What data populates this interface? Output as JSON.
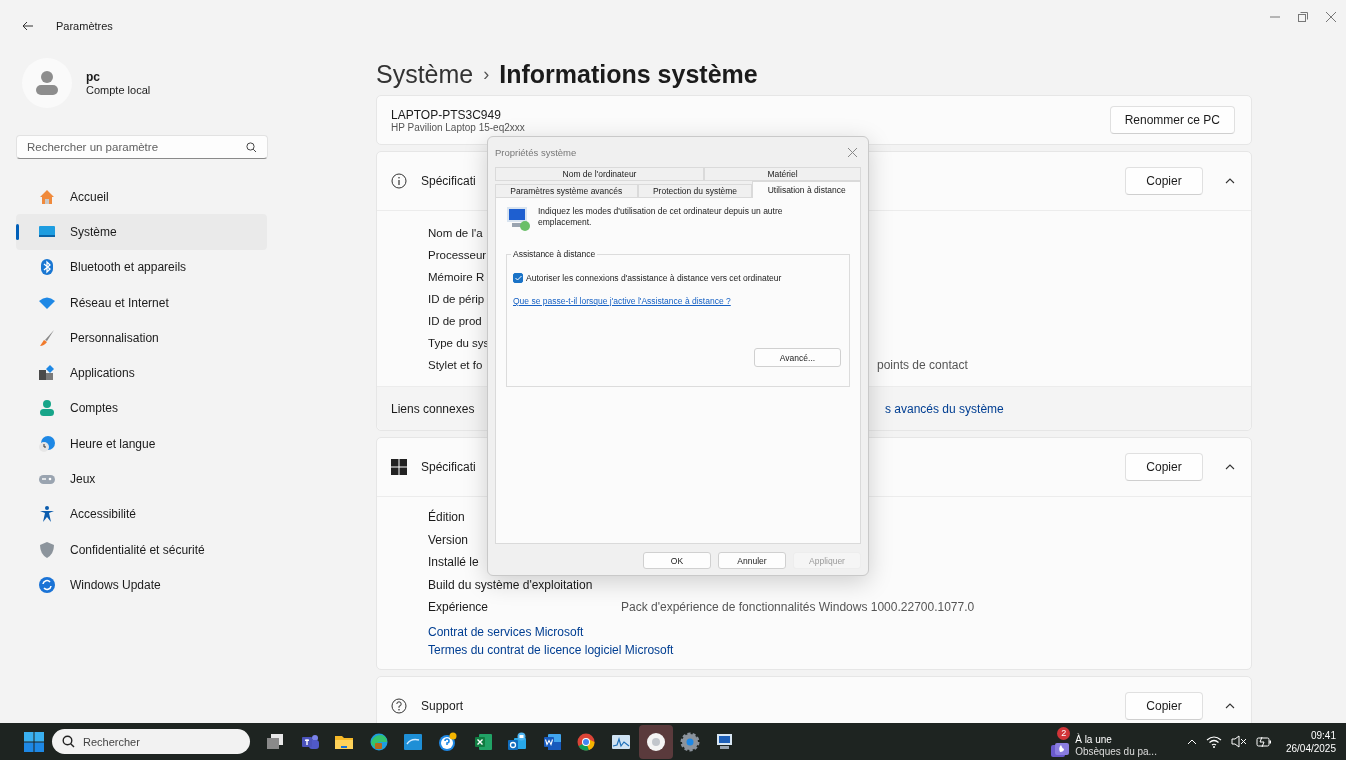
{
  "window": {
    "title": "Paramètres"
  },
  "account": {
    "name": "pc",
    "type": "Compte local"
  },
  "search": {
    "placeholder": "Rechercher un paramètre"
  },
  "nav": [
    {
      "label": "Accueil",
      "selected": false
    },
    {
      "label": "Système",
      "selected": true
    },
    {
      "label": "Bluetooth et appareils",
      "selected": false
    },
    {
      "label": "Réseau et Internet",
      "selected": false
    },
    {
      "label": "Personnalisation",
      "selected": false
    },
    {
      "label": "Applications",
      "selected": false
    },
    {
      "label": "Comptes",
      "selected": false
    },
    {
      "label": "Heure et langue",
      "selected": false
    },
    {
      "label": "Jeux",
      "selected": false
    },
    {
      "label": "Accessibilité",
      "selected": false
    },
    {
      "label": "Confidentialité et sécurité",
      "selected": false
    },
    {
      "label": "Windows Update",
      "selected": false
    }
  ],
  "breadcrumb": {
    "parent": "Système",
    "separator": "›",
    "current": "Informations système"
  },
  "device": {
    "name": "LAPTOP-PTS3C949",
    "model": "HP Pavilion Laptop 15-eq2xxx",
    "button": "Renommer ce PC"
  },
  "sections": [
    {
      "kind": "device",
      "title": "Spécificati",
      "button": "Copier",
      "expanded": true,
      "rows": [
        {
          "label": "Nom de l'a"
        },
        {
          "label": "Processeur"
        },
        {
          "label": "Mémoire R"
        },
        {
          "label": "ID de périp"
        },
        {
          "label": "ID de prod"
        },
        {
          "label": "Type du sys"
        },
        {
          "label": "Stylet et fo",
          "value_tail": "points de contact"
        }
      ],
      "related": {
        "label": "Liens connexes",
        "link_tail": "s avancés du système"
      }
    },
    {
      "kind": "windows",
      "title": "Spécificati",
      "button": "Copier",
      "expanded": true,
      "rows": [
        {
          "label": "Édition"
        },
        {
          "label": "Version"
        },
        {
          "label": "Installé le"
        },
        {
          "label": "Build du système d'exploitation"
        },
        {
          "label": "Expérience",
          "value": "Pack d'expérience de fonctionnalités Windows 1000.22700.1077.0"
        }
      ],
      "links": [
        "Contrat de services Microsoft",
        "Termes du contrat de licence logiciel Microsoft"
      ]
    },
    {
      "kind": "support",
      "title": "Support",
      "button": "Copier",
      "expanded": true
    }
  ],
  "dialog": {
    "title": "Propriétés système",
    "tabs_back": [
      {
        "label": "Nom de l'ordinateur",
        "selected": false
      },
      {
        "label": "Matériel",
        "selected": false
      }
    ],
    "tabs_front": [
      {
        "label": "Paramètres système avancés",
        "selected": false
      },
      {
        "label": "Protection du système",
        "selected": false
      },
      {
        "label": "Utilisation à distance",
        "selected": true
      }
    ],
    "intro": "Indiquez les modes d'utilisation de cet ordinateur depuis un autre emplacement.",
    "group": {
      "title": "Assistance à distance",
      "checkbox": {
        "label": "Autoriser les connexions d'assistance à distance vers cet ordinateur",
        "checked": true
      },
      "link": "Que se passe-t-il lorsque j'active l'Assistance à distance ?",
      "button": "Avancé..."
    },
    "buttons": [
      {
        "label": "OK",
        "disabled": false
      },
      {
        "label": "Annuler",
        "disabled": false
      },
      {
        "label": "Appliquer",
        "disabled": true
      }
    ]
  },
  "taskbar": {
    "search": "Rechercher",
    "apps": [
      {
        "kind": "taskview",
        "active": false
      },
      {
        "kind": "teams",
        "active": false
      },
      {
        "kind": "folder",
        "active": false
      },
      {
        "kind": "edge",
        "active": false
      },
      {
        "kind": "tile",
        "active": false
      },
      {
        "kind": "help",
        "active": false
      },
      {
        "kind": "excel",
        "active": false
      },
      {
        "kind": "outlook",
        "active": false
      },
      {
        "kind": "word",
        "active": false
      },
      {
        "kind": "chrome",
        "active": false
      },
      {
        "kind": "monitor",
        "active": false
      },
      {
        "kind": "circle",
        "active": true
      },
      {
        "kind": "gear",
        "active": false
      },
      {
        "kind": "remote",
        "active": false
      }
    ],
    "news": {
      "badge": "2",
      "title": "À la une",
      "subtitle": "Obsèques du pa..."
    },
    "time": "09:41",
    "date": "26/04/2025"
  }
}
